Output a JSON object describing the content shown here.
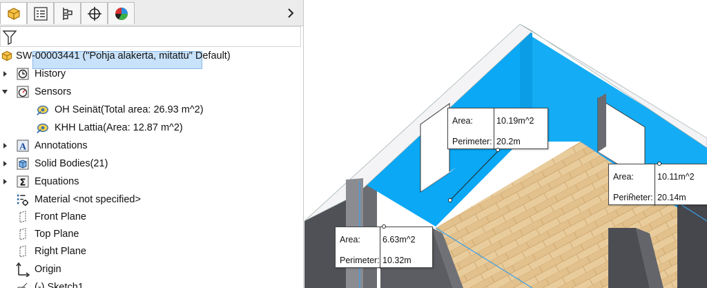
{
  "tabs": [
    {
      "name": "featuremanager-tab",
      "icon": "part-cube-icon"
    },
    {
      "name": "propertymanager-tab",
      "icon": "property-list-icon"
    },
    {
      "name": "configurationmanager-tab",
      "icon": "configuration-icon"
    },
    {
      "name": "dimxpert-tab",
      "icon": "crosshair-icon"
    },
    {
      "name": "display-manager-tab",
      "icon": "appearance-sphere-icon"
    }
  ],
  "tree": {
    "root": "SW-00003441 (\"Pohja alakerta, mitattu\" Default)",
    "items": [
      {
        "label": "History",
        "icon": "history-clock-icon"
      },
      {
        "label": "Sensors",
        "icon": "sensor-gauge-icon"
      },
      {
        "label": "OH Seinät(Total area: 26.93 m^2)",
        "icon": "measure-sensor-icon"
      },
      {
        "label": "KHH Lattia(Area: 12.87 m^2)",
        "icon": "measure-sensor-icon"
      },
      {
        "label": "Annotations",
        "icon": "annotation-a-icon"
      },
      {
        "label": "Solid Bodies(21)",
        "icon": "solid-body-icon"
      },
      {
        "label": "Equations",
        "icon": "sigma-icon"
      },
      {
        "label": "Material <not specified>",
        "icon": "material-icon"
      },
      {
        "label": "Front Plane",
        "icon": "plane-icon"
      },
      {
        "label": "Top Plane",
        "icon": "plane-icon"
      },
      {
        "label": "Right Plane",
        "icon": "plane-icon"
      },
      {
        "label": "Origin",
        "icon": "origin-axes-icon"
      },
      {
        "label": "(-) Sketch1",
        "icon": "sketch-icon"
      }
    ]
  },
  "callouts": [
    {
      "area_label": "Area:",
      "area_value": "10.19m^2",
      "perimeter_label": "Perimeter:",
      "perimeter_value": "20.2m"
    },
    {
      "area_label": "Area:",
      "area_value": "10.11m^2",
      "perimeter_label": "Perimeter:",
      "perimeter_value": "20.14m"
    },
    {
      "area_label": "Area:",
      "area_value": "6.63m^2",
      "perimeter_label": "Perimeter:",
      "perimeter_value": "10.32m"
    }
  ],
  "colors": {
    "wall_highlight": "#0aa8f5",
    "wall_dark": "#5b5d63",
    "floor_wood": "#e6c89a",
    "selection": "#c8e2fb"
  }
}
